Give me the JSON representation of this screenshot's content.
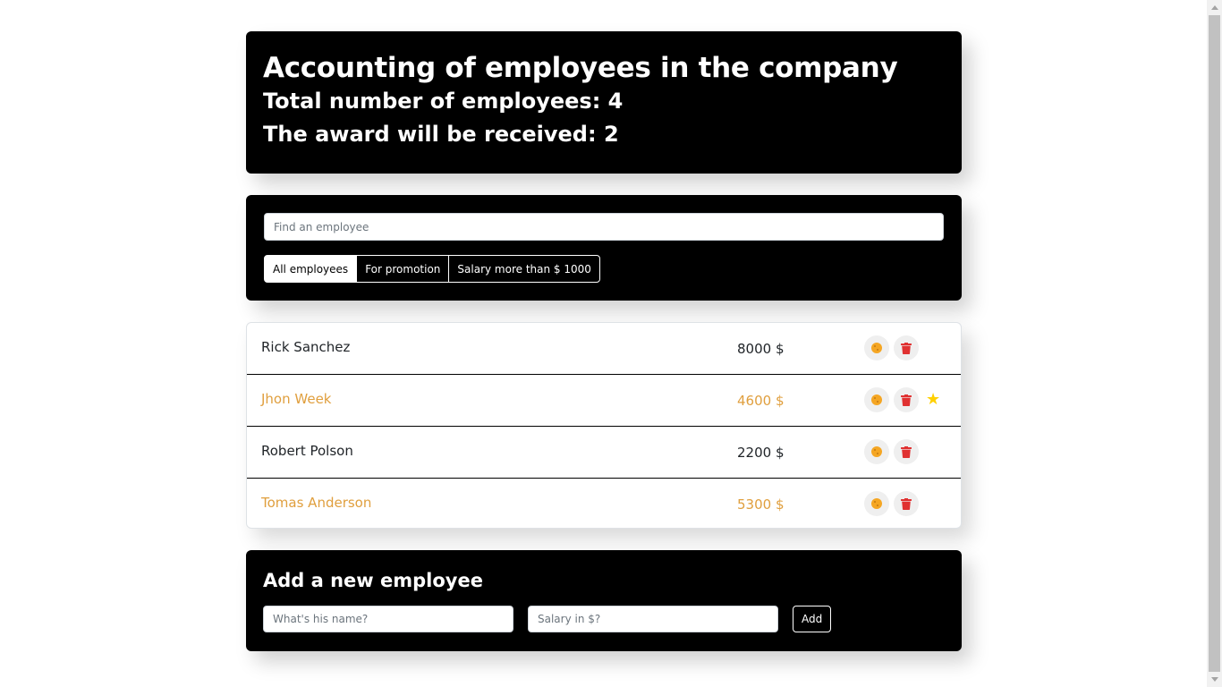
{
  "header": {
    "title": "Accounting of employees in the company",
    "total": "Total number of employees: 4",
    "award": "The award will be received: 2"
  },
  "search": {
    "placeholder": "Find an employee",
    "filters": [
      {
        "label": "All employees",
        "active": true
      },
      {
        "label": "For promotion",
        "active": false
      },
      {
        "label": "Salary more than $ 1000",
        "active": false
      }
    ]
  },
  "employees": [
    {
      "name": "Rick Sanchez",
      "salary": "8000 $",
      "increase": false,
      "rise": false
    },
    {
      "name": "Jhon Week",
      "salary": "4600 $",
      "increase": true,
      "rise": true
    },
    {
      "name": "Robert Polson",
      "salary": "2200 $",
      "increase": false,
      "rise": false
    },
    {
      "name": "Tomas Anderson",
      "salary": "5300 $",
      "increase": true,
      "rise": false
    }
  ],
  "add_form": {
    "title": "Add a new employee",
    "name_placeholder": "What's his name?",
    "salary_placeholder": "Salary in $?",
    "submit_label": "Add"
  },
  "icons": {
    "cookie": "cookie-icon",
    "trash": "trash-icon",
    "star": "star-icon"
  },
  "colors": {
    "panel_bg": "#000000",
    "increase_text": "#e09f3e",
    "cookie": "#f5a623",
    "trash": "#e03131",
    "star": "#ffd000"
  }
}
